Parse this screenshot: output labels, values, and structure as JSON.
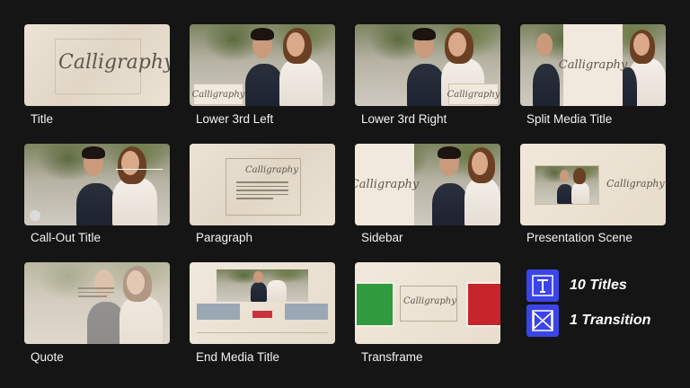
{
  "templates": [
    {
      "id": "title",
      "label": "Title",
      "scene_text": "Calligraphy"
    },
    {
      "id": "lower-3rd-left",
      "label": "Lower 3rd Left",
      "scene_text": "Calligraphy"
    },
    {
      "id": "lower-3rd-right",
      "label": "Lower 3rd Right",
      "scene_text": "Calligraphy"
    },
    {
      "id": "split-media-title",
      "label": "Split Media Title",
      "scene_text": "Calligraphy"
    },
    {
      "id": "call-out-title",
      "label": "Call-Out Title"
    },
    {
      "id": "paragraph",
      "label": "Paragraph",
      "scene_text": "Calligraphy"
    },
    {
      "id": "sidebar",
      "label": "Sidebar",
      "scene_text": "Calligraphy"
    },
    {
      "id": "presentation-scene",
      "label": "Presentation Scene",
      "scene_text": "Calligraphy"
    },
    {
      "id": "quote",
      "label": "Quote"
    },
    {
      "id": "end-media-title",
      "label": "End Media Title"
    },
    {
      "id": "transframe",
      "label": "Transframe",
      "scene_text": "Calligraphy"
    }
  ],
  "legend": {
    "titles": {
      "icon": "title-t-icon",
      "text": "10 Titles"
    },
    "transition": {
      "icon": "transition-bowtie-icon",
      "text": "1 Transition"
    }
  },
  "colors": {
    "background": "#151515",
    "legend_icon": "#3b44e6",
    "transframe_green": "#2f9a3e",
    "transframe_red": "#c4262b"
  }
}
